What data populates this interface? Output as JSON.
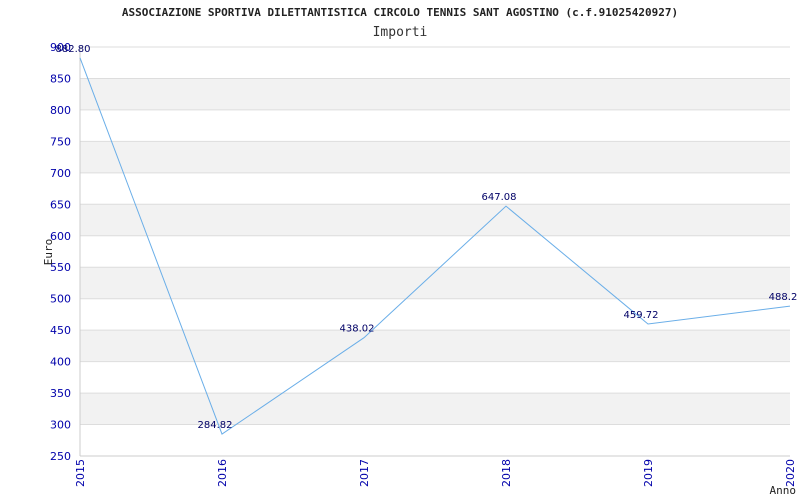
{
  "chart_data": {
    "type": "line",
    "title": "ASSOCIAZIONE SPORTIVA DILETTANTISTICA CIRCOLO TENNIS SANT AGOSTINO (c.f.91025420927)",
    "subtitle": "Importi",
    "xlabel": "Anno",
    "ylabel": "Euro",
    "categories": [
      "2015",
      "2016",
      "2017",
      "2018",
      "2019",
      "2020"
    ],
    "series": [
      {
        "values": [
          882.8,
          284.82,
          438.02,
          647.08,
          459.72,
          488.2
        ],
        "labels": [
          "882.80",
          "284.82",
          "438.02",
          "647.08",
          "459.72",
          "488.2"
        ]
      }
    ],
    "ylim": [
      250,
      900
    ],
    "yticks": [
      "250",
      "300",
      "350",
      "400",
      "450",
      "500",
      "550",
      "600",
      "650",
      "700",
      "750",
      "800",
      "850",
      "900"
    ],
    "grid": true,
    "colors": {
      "line": "#6aaee8",
      "band": "#f2f2f2",
      "tick": "#0000aa"
    }
  }
}
